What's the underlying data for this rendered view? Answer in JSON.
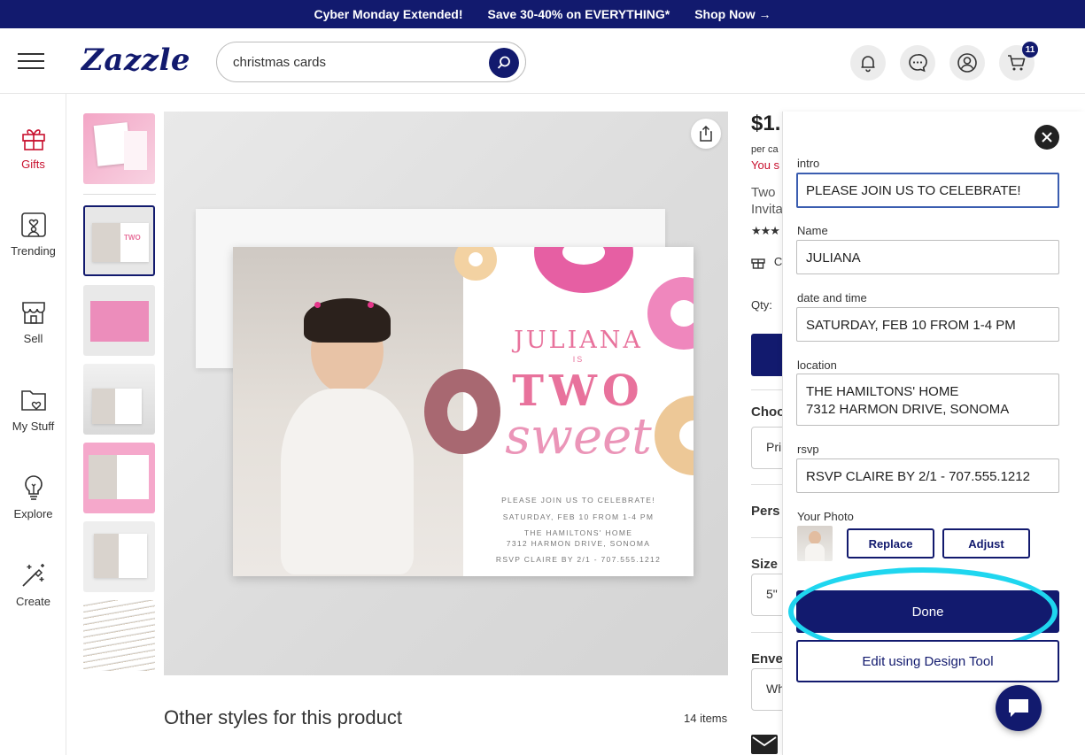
{
  "promo": {
    "item1": "Cyber Monday Extended!",
    "item2": "Save 30-40% on EVERYTHING*",
    "item3": "Shop Now →"
  },
  "header": {
    "logo": "Zazzle",
    "search_value": "christmas cards",
    "cart_count": "11",
    "icons": [
      "menu-icon",
      "search-icon",
      "bell-icon",
      "chat-icon",
      "account-icon",
      "cart-icon"
    ]
  },
  "sidebar": {
    "items": [
      {
        "label": "Gifts",
        "icon": "gift-icon"
      },
      {
        "label": "Trending",
        "icon": "trending-icon"
      },
      {
        "label": "Sell",
        "icon": "store-icon"
      },
      {
        "label": "My Stuff",
        "icon": "folder-icon"
      },
      {
        "label": "Explore",
        "icon": "lightbulb-icon"
      },
      {
        "label": "Create",
        "icon": "magic-wand-icon"
      }
    ],
    "active_color": "#c8102e"
  },
  "card": {
    "name": "JULIANA",
    "is": "IS",
    "two": "TWO",
    "sweet": "sweet",
    "line1": "PLEASE JOIN US TO CELEBRATE!",
    "line2": "SATURDAY, FEB 10 FROM 1-4 PM",
    "line3": "THE HAMILTONS' HOME",
    "line4": "7312 HARMON DRIVE, SONOMA",
    "line5": "RSVP CLAIRE BY 2/1 - 707.555.1212"
  },
  "product": {
    "price": "$1.",
    "per": "per ca",
    "you_save": "You s",
    "title1": "Two",
    "title2": "Invita",
    "gift_text": "C",
    "qty_label": "Qty:",
    "choose": "Choo",
    "pri": "Pri",
    "personalize": "Pers",
    "size": "Size",
    "size_val": "5\"",
    "envelope": "Enve",
    "env_val": "Wh"
  },
  "other_styles": {
    "title": "Other styles for this product",
    "count": "14 items"
  },
  "panel": {
    "fields": [
      {
        "label": "intro",
        "value": "PLEASE JOIN US TO CELEBRATE!"
      },
      {
        "label": "Name",
        "value": "JULIANA"
      },
      {
        "label": "date and time",
        "value": "SATURDAY, FEB 10 FROM 1-4 PM"
      },
      {
        "label": "location",
        "value": "THE HAMILTONS' HOME\n7312 HARMON DRIVE, SONOMA"
      },
      {
        "label": "rsvp",
        "value": "RSVP CLAIRE BY 2/1 - 707.555.1212"
      }
    ],
    "photo_label": "Your Photo",
    "replace": "Replace",
    "adjust": "Adjust",
    "done": "Done",
    "design_tool": "Edit using Design Tool"
  },
  "colors": {
    "brand": "#121a6e",
    "highlight": "#1fd6ef",
    "pink": "#e8729c"
  }
}
